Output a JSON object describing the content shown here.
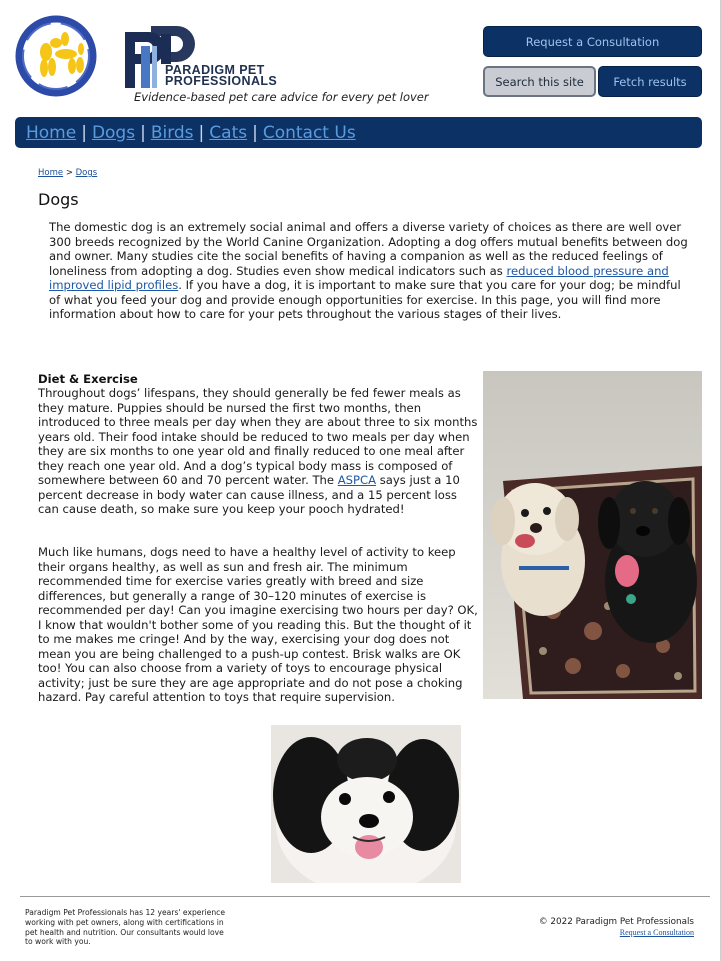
{
  "header": {
    "brand_line1": "Paradigm Pet",
    "brand_line2": "Professionals",
    "tagline": "Evidence-based pet care advice for every pet lover",
    "consult_label": "Request a Consultation",
    "search_placeholder": "Search this site",
    "fetch_label": "Fetch results"
  },
  "nav": {
    "items": [
      "Home",
      "Dogs",
      "Birds",
      "Cats",
      "Contact Us"
    ],
    "separator": "|"
  },
  "breadcrumb": {
    "home": "Home",
    "separator": ">",
    "current": "Dogs"
  },
  "page": {
    "title": "Dogs",
    "intro_before": "The domestic dog is an extremely social animal and offers a diverse variety of choices as there are well over 300 breeds recognized by the World Canine Organization. Adopting a dog offers mutual benefits between dog and owner. Many studies cite the social benefits of having a companion as well as the reduced feelings of loneliness from adopting a dog. Studies even show medical indicators such as ",
    "intro_link": "reduced blood pressure and improved lipid profiles",
    "intro_after": ". If you have a dog, it is important to make sure that you care for your dog; be mindful of what you feed your dog and provide enough opportunities for exercise. In this page, you will find more information about how to care for your pets throughout the various stages of their lives.",
    "section_title": "Diet & Exercise",
    "para1_before": "Throughout dogs’ lifespans, they should generally be fed fewer meals as they mature. Puppies should be nursed the first two months, then introduced to three meals per day when they are about three to six months years old. Their food intake should be reduced to two meals per day when they are six months to one year old and finally reduced to one meal after they reach one year old. And a dog’s typical body mass is composed of somewhere between 60 and 70 percent water. The ",
    "para1_link": "ASPCA",
    "para1_after": " says just a 10 percent decrease in body water can cause illness, and a 15 percent loss can cause death, so make sure you keep your pooch hydrated!",
    "para2": "Much like humans, dogs need to have a healthy level of activity to keep their organs healthy, as well as sun and fresh air. The minimum recommended time for exercise varies greatly with breed and size differences, but generally a range of 30–120 minutes of exercise is recommended per day! Can you imagine exercising two hours per day? OK, I know that wouldn't bother some of you reading this. But the thought of it to me makes me cringe! And by the way, exercising your dog does not mean you are being challenged to a push-up contest. Brisk walks are OK too! You can also choose from a variety of toys to encourage physical activity; just be sure they are age appropriate and do not pose a choking hazard. Pay careful attention to toys that require supervision."
  },
  "footer": {
    "about": "Paradigm Pet Professionals has 12 years' experience working with pet owners, along with certifications in pet health and nutrition. Our consultants would love to work with you.",
    "copyright": "© 2022 Paradigm Pet Professionals",
    "link": "Request a Consultation"
  },
  "colors": {
    "navy": "#0c3165",
    "nav_link": "#5a9bdd",
    "button_text": "#9fc3ee",
    "logo_blue": "#2c4aa8",
    "logo_yellow": "#f5c518"
  },
  "icons": {
    "logo": "dog-balloon-logo-icon",
    "brand": "paradigm-pp-monogram-icon"
  }
}
